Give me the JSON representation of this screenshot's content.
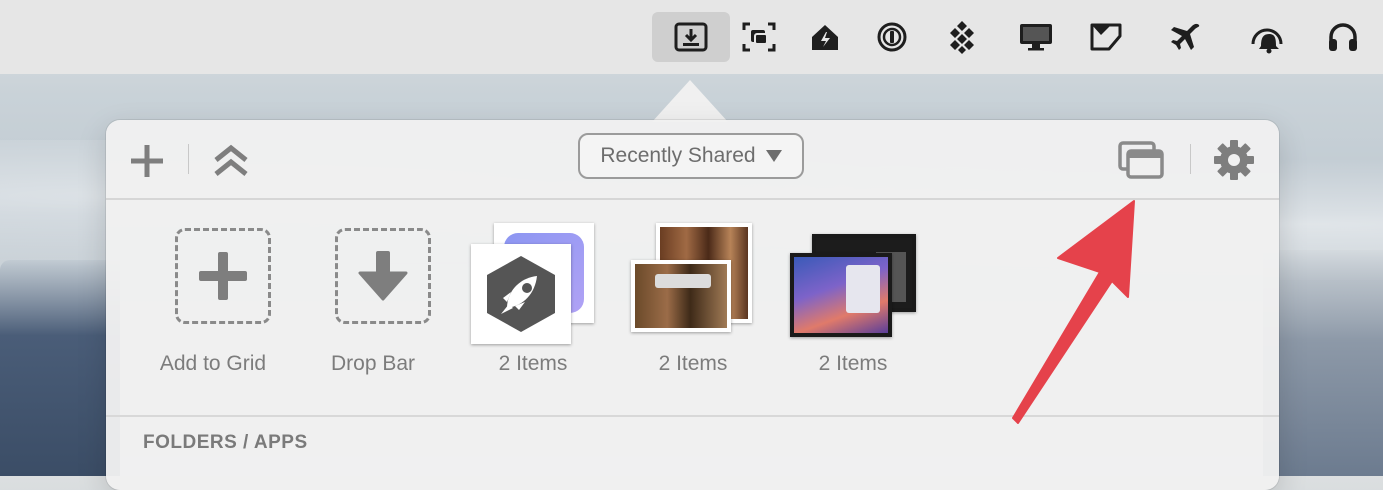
{
  "menubar": {
    "icons": [
      "dropzone-download-icon",
      "screenshot-capture-icon",
      "home-icon",
      "1password-icon",
      "sparkle-diamonds-icon",
      "display-icon",
      "notch-icon",
      "airplane-icon",
      "notification-bell-icon",
      "headphones-icon"
    ]
  },
  "toolbar": {
    "source_selected": "Recently Shared"
  },
  "grid": {
    "add_label": "Add to Grid",
    "drop_bar_label": "Drop Bar",
    "items": [
      {
        "label": "2 Items"
      },
      {
        "label": "2 Items"
      },
      {
        "label": "2 Items"
      }
    ]
  },
  "sections": {
    "folders_apps": "FOLDERS / APPS"
  },
  "colors": {
    "annotation_arrow": "#e5424b",
    "menubar_bg": "#e6e6e6",
    "panel_bg": "#f0f0f0"
  }
}
